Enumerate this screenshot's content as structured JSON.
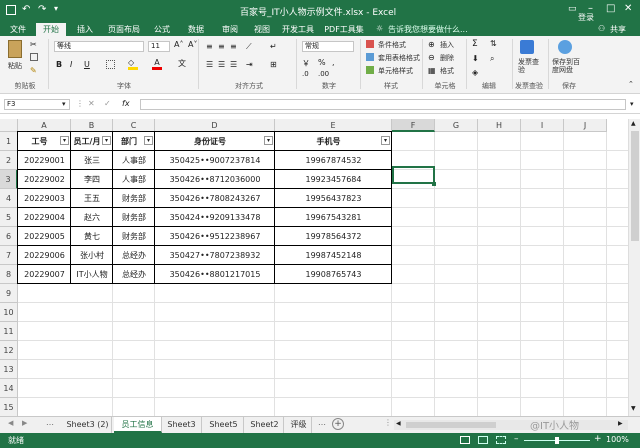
{
  "window": {
    "title": "百家号_IT小人物示例文件.xlsx - Excel",
    "login": "登录"
  },
  "ribbon_tabs": [
    "文件",
    "开始",
    "插入",
    "页面布局",
    "公式",
    "数据",
    "审阅",
    "视图",
    "开发工具",
    "PDF工具集"
  ],
  "tell_me": "告诉我您想要做什么...",
  "share": "共享",
  "ribbon": {
    "paste": "粘贴",
    "font_name": "等线",
    "font_size": "11",
    "wrap_format": "常规",
    "conditional_format": "条件格式",
    "table_format": "套用表格格式",
    "cell_style": "单元格样式",
    "insert": "插入",
    "delete": "删除",
    "format": "格式",
    "send_check": "发票查验",
    "save_to": "保存到百度网盘",
    "groups": {
      "clipboard": "剪贴板",
      "font": "字体",
      "align": "对齐方式",
      "number": "数字",
      "style": "样式",
      "cells": "单元格",
      "edit": "编辑",
      "invoice": "发票查验",
      "save": "保存"
    }
  },
  "formula_bar": {
    "name_box": "F3",
    "fx": "fx",
    "value": ""
  },
  "columns": [
    "A",
    "B",
    "C",
    "D",
    "E",
    "F",
    "G",
    "H",
    "I",
    "J"
  ],
  "rows": [
    "1",
    "2",
    "3",
    "4",
    "5",
    "6",
    "7",
    "8",
    "9",
    "10",
    "11",
    "12",
    "13",
    "14",
    "15"
  ],
  "table": {
    "headers": [
      "工号",
      "员工/月",
      "部门",
      "身份证号",
      "手机号"
    ],
    "data": [
      [
        "20229001",
        "张三",
        "人事部",
        "350425••9007237814",
        "19967874532"
      ],
      [
        "20229002",
        "李四",
        "人事部",
        "350426••8712036000",
        "19923457684"
      ],
      [
        "20229003",
        "王五",
        "财务部",
        "350426••7808243267",
        "19956437823"
      ],
      [
        "20229004",
        "赵六",
        "财务部",
        "350424••9209133478",
        "19967543281"
      ],
      [
        "20229005",
        "黄七",
        "财务部",
        "350426••9512238967",
        "19978564372"
      ],
      [
        "20229006",
        "张小村",
        "总经办",
        "350427••7807238932",
        "19987452148"
      ],
      [
        "20229007",
        "IT小人物",
        "总经办",
        "350426••8801217015",
        "19908765743"
      ]
    ]
  },
  "sheets": [
    "Sheet3 (2)",
    "员工信息",
    "Sheet3",
    "Sheet5",
    "Sheet2",
    "评级"
  ],
  "active_sheet": "员工信息",
  "status": {
    "ready": "就绪",
    "zoom": "100%"
  },
  "watermark": "@IT小人物"
}
